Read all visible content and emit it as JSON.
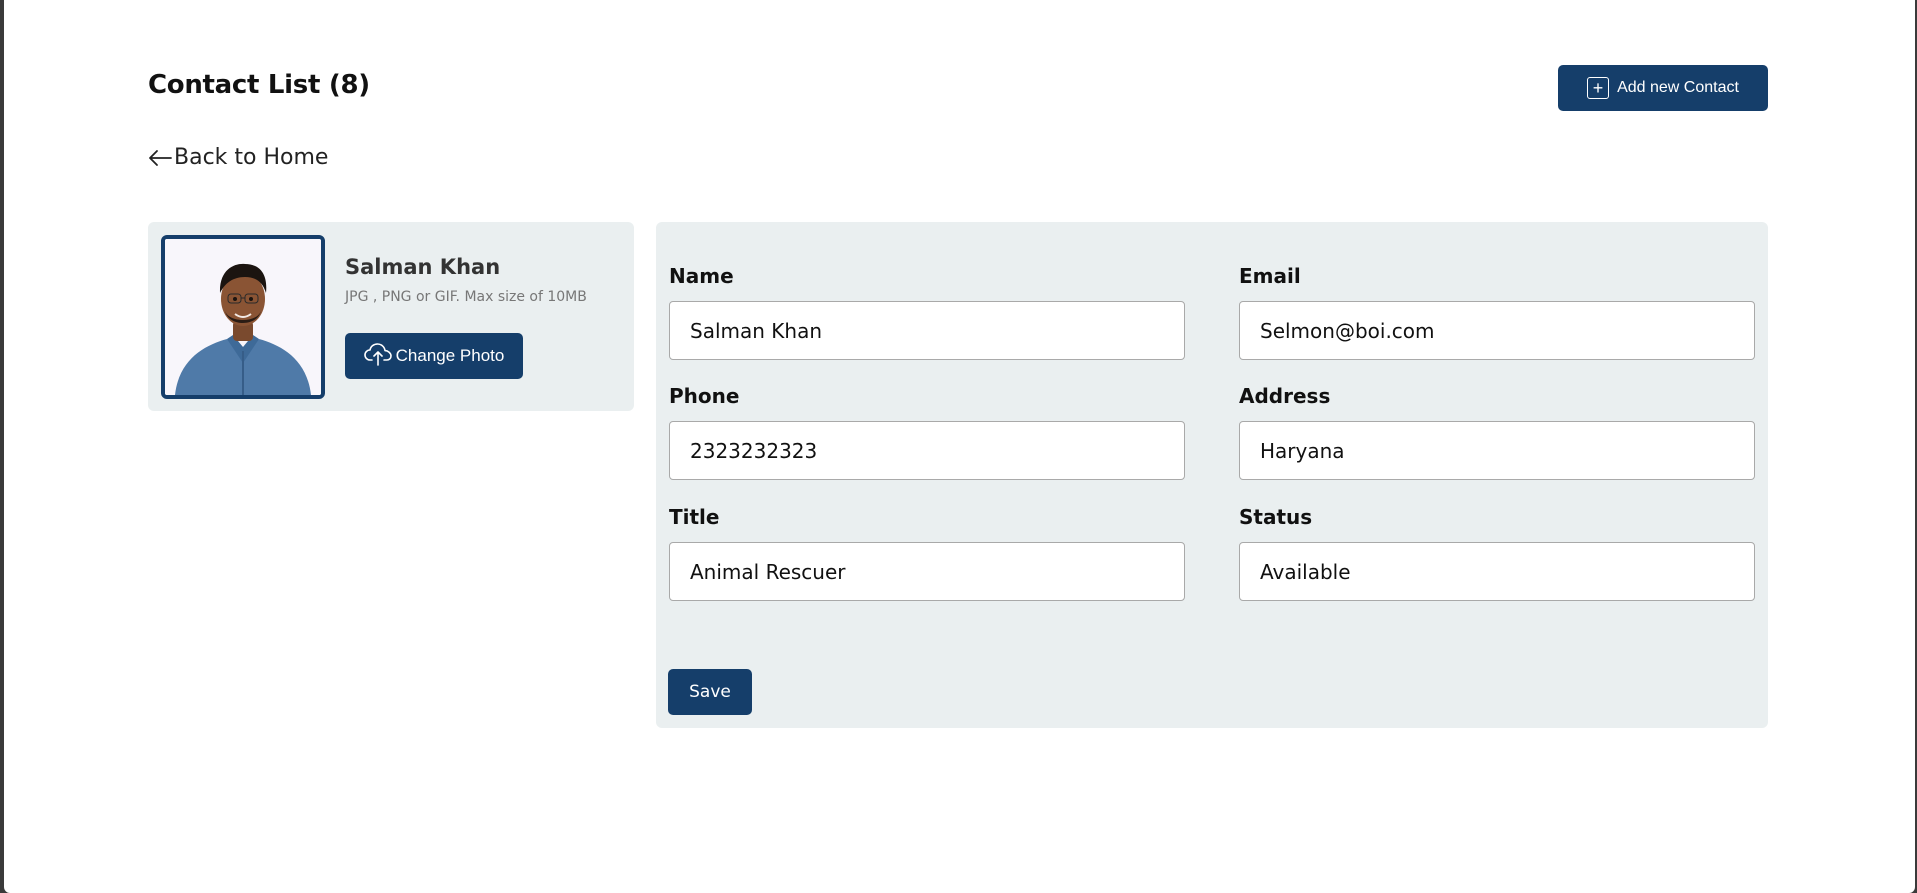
{
  "header": {
    "title": "Contact List (8)",
    "add_button_label": "Add new Contact",
    "back_link_label": "Back to Home"
  },
  "profile": {
    "name": "Salman Khan",
    "hint": "JPG , PNG or GIF. Max size of 10MB",
    "change_photo_label": "Change Photo"
  },
  "form": {
    "name": {
      "label": "Name",
      "value": "Salman Khan"
    },
    "email": {
      "label": "Email",
      "value": "Selmon@boi.com"
    },
    "phone": {
      "label": "Phone",
      "value": "2323232323"
    },
    "address": {
      "label": "Address",
      "value": "Haryana"
    },
    "title": {
      "label": "Title",
      "value": "Animal Rescuer"
    },
    "status": {
      "label": "Status",
      "value": "Available"
    },
    "save_label": "Save"
  },
  "colors": {
    "primary": "#153e6a",
    "panel": "#eaeff0",
    "background": "#ffffff"
  },
  "icons": {
    "add": "plus-square-icon",
    "back": "arrow-left-icon",
    "upload": "cloud-upload-icon"
  }
}
